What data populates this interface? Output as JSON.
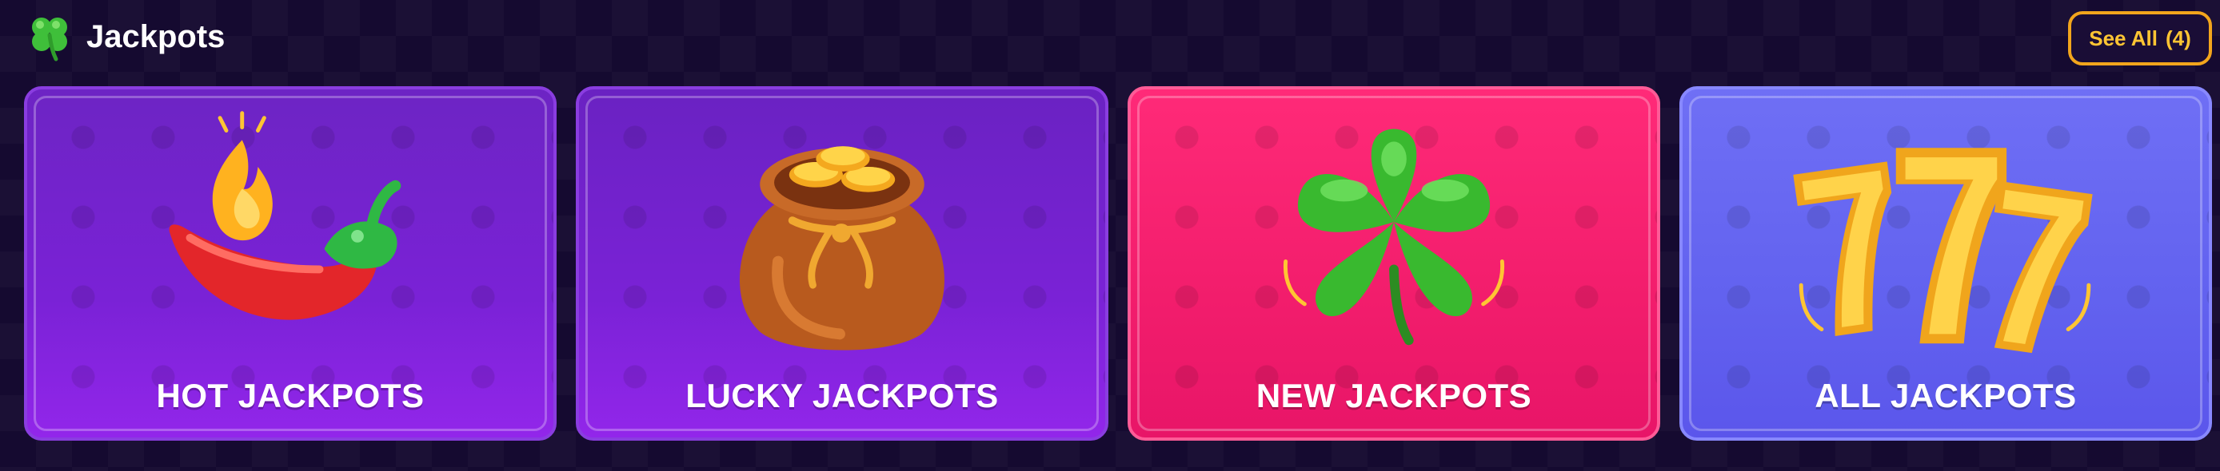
{
  "header": {
    "title": "Jackpots",
    "icon": "clover-icon",
    "see_all_label": "See All",
    "see_all_count": "(4)"
  },
  "cards": [
    {
      "label": "HOT JACKPOTS",
      "icon": "hot-pepper-fire-icon"
    },
    {
      "label": "LUCKY JACKPOTS",
      "icon": "gold-coin-bag-icon"
    },
    {
      "label": "NEW JACKPOTS",
      "icon": "four-leaf-clover-icon"
    },
    {
      "label": "ALL JACKPOTS",
      "icon": "triple-seven-icon"
    }
  ],
  "colors": {
    "background": "#150a30",
    "accent": "#f2a51c",
    "hot_card": "#7a22d6",
    "lucky_card": "#7a22d6",
    "new_card": "#f21d6c",
    "all_card": "#6262ef"
  }
}
